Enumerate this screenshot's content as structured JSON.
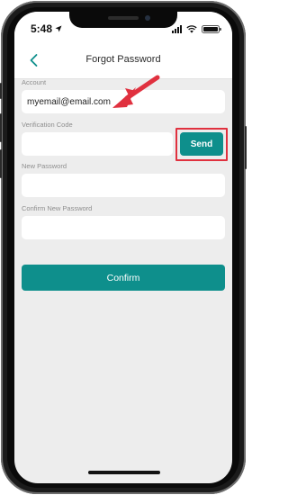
{
  "status_bar": {
    "time": "5:48"
  },
  "header": {
    "title": "Forgot Password"
  },
  "form": {
    "account": {
      "label": "Account",
      "value": "myemail@email.com"
    },
    "verification_code": {
      "label": "Verification Code",
      "value": ""
    },
    "send_label": "Send",
    "new_password": {
      "label": "New Password",
      "value": ""
    },
    "confirm_new_password": {
      "label": "Confirm New Password",
      "value": ""
    },
    "confirm_label": "Confirm"
  },
  "colors": {
    "accent": "#0e8f8c",
    "annotation": "#e0313f",
    "background": "#ededed"
  },
  "annotations": {
    "arrow_icon": "arrow-pointer-icon",
    "highlight": "send-highlight-box"
  }
}
